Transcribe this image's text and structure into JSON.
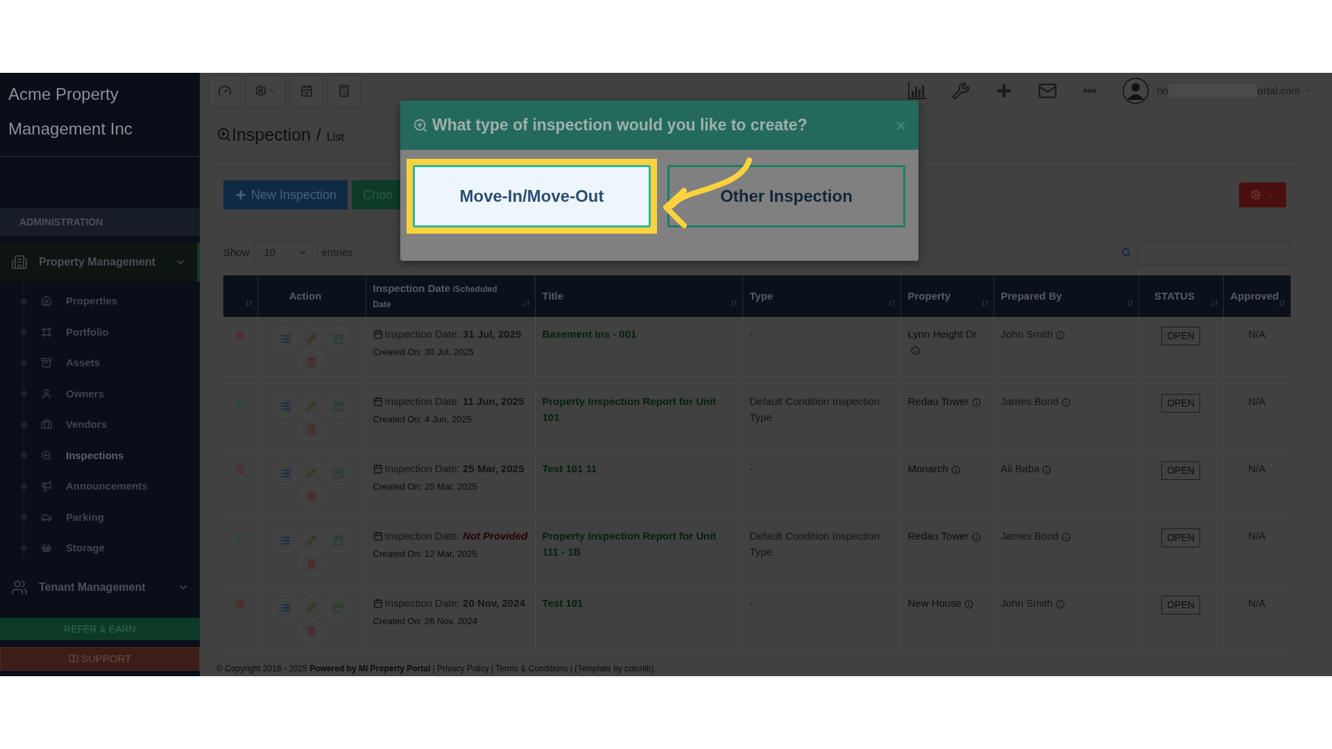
{
  "sidebar": {
    "brand": "Acme Property Management Inc",
    "section": "ADMINISTRATION",
    "groups": [
      {
        "label": "Property Management",
        "children": [
          {
            "label": "Properties",
            "selected": false
          },
          {
            "label": "Portfolio",
            "selected": false
          },
          {
            "label": "Assets",
            "selected": false
          },
          {
            "label": "Owners",
            "selected": false
          },
          {
            "label": "Vendors",
            "selected": false
          },
          {
            "label": "Inspections",
            "selected": true
          },
          {
            "label": "Announcements",
            "selected": false
          },
          {
            "label": "Parking",
            "selected": false
          },
          {
            "label": "Storage",
            "selected": false
          }
        ]
      },
      {
        "label": "Tenant Management"
      }
    ],
    "refer": "REFER & EARN",
    "support": "SUPPORT"
  },
  "header": {
    "user_email_start": "no",
    "user_email_end": "ortal.com"
  },
  "page": {
    "title": "Inspection",
    "separator": "/",
    "breadcrumb": "List",
    "buttons": [
      "New Inspection",
      "Choo"
    ],
    "show_label": "Show",
    "page_size": "10",
    "entries_label": "entries"
  },
  "table": {
    "columns": [
      {
        "sortable": true
      },
      {
        "label": "Action",
        "sortable": false
      },
      {
        "label": "Inspection Date",
        "sublabel": "/Scheduled Date",
        "sortable": true
      },
      {
        "label": "Title",
        "sortable": true
      },
      {
        "label": "Type",
        "sortable": true
      },
      {
        "label": "Property",
        "sortable": true
      },
      {
        "label": "Prepared By",
        "sortable": true
      },
      {
        "label": "STATUS",
        "sortable": true
      },
      {
        "label": "Approved",
        "sortable": true
      }
    ],
    "rows": [
      {
        "kind": "zoom",
        "date_label": "Inspection Date:",
        "date": "31 Jul, 2025",
        "date_provided": true,
        "created": "Created On: 30 Jul, 2025",
        "title": "Basement Ins - 001",
        "type": "-",
        "property": "Lynn Height Dr",
        "prepared_by": "John Smith",
        "status": "OPEN",
        "approved": "N/A"
      },
      {
        "kind": "key",
        "date_label": "Inspection Date:",
        "date": "11 Jun, 2025",
        "date_provided": true,
        "created": "Created On: 4 Jun, 2025",
        "title": "Property Inspection Report for Unit 101",
        "type": "Default Condition Inspection Type",
        "property": "Redau Tower",
        "prepared_by": "James Bond",
        "status": "OPEN",
        "approved": "N/A"
      },
      {
        "kind": "zoom",
        "date_label": "Inspection Date:",
        "date": "25 Mar, 2025",
        "date_provided": true,
        "created": "Created On: 25 Mar, 2025",
        "title": "Test 101 11",
        "type": "-",
        "property": "Monarch",
        "prepared_by": "Ali Baba",
        "status": "OPEN",
        "approved": "N/A"
      },
      {
        "kind": "key",
        "date_label": "Inspection Date:",
        "date": "Not Provided",
        "date_provided": false,
        "created": "Created On: 12 Mar, 2025",
        "title": "Property Inspection Report for Unit 111 - 1B",
        "type": "Default Condition Inspection Type",
        "property": "Redau Tower",
        "prepared_by": "James Bond",
        "status": "OPEN",
        "approved": "N/A"
      },
      {
        "kind": "zoom",
        "date_label": "Inspection Date:",
        "date": "20 Nov, 2024",
        "date_provided": true,
        "created": "Created On: 26 Nov, 2024",
        "title": "Test 101",
        "type": "-",
        "property": "New House",
        "prepared_by": "John Smith",
        "status": "OPEN",
        "approved": "N/A"
      }
    ]
  },
  "footer": "© Copyright 2016 - 2025 **Powered by MI Property Portal** | Privacy Policy | Terms & Conditions | (Template by colorlib)",
  "modal": {
    "title": "What type of inspection would you like to create?",
    "close": "×",
    "options": [
      {
        "label": "Move-In/Move-Out",
        "selected": true
      },
      {
        "label": "Other Inspection",
        "selected": false
      }
    ]
  }
}
